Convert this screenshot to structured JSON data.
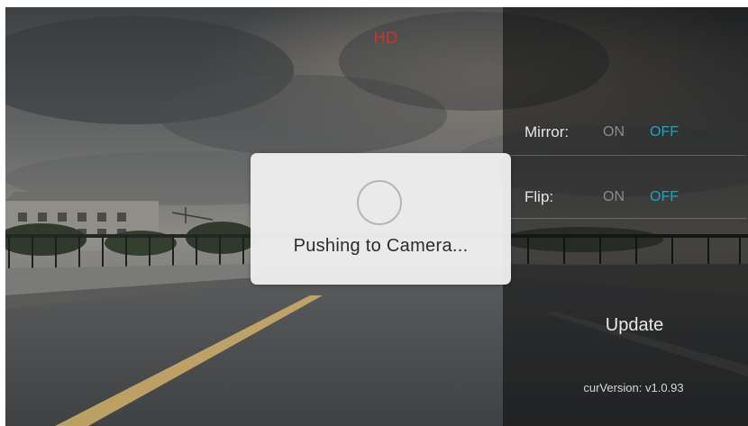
{
  "preview": {
    "quality_badge": "HD",
    "badge_color": "#c8342c"
  },
  "settings": {
    "mirror": {
      "label": "Mirror:",
      "on_label": "ON",
      "off_label": "OFF",
      "selected": "OFF"
    },
    "flip": {
      "label": "Flip:",
      "on_label": "ON",
      "off_label": "OFF",
      "selected": "OFF"
    },
    "active_color": "#1aa5c4",
    "update_label": "Update",
    "version_text": "curVersion: v1.0.93"
  },
  "dialog": {
    "message": "Pushing to Camera...",
    "spinner_icon": "loading-spinner-icon"
  }
}
